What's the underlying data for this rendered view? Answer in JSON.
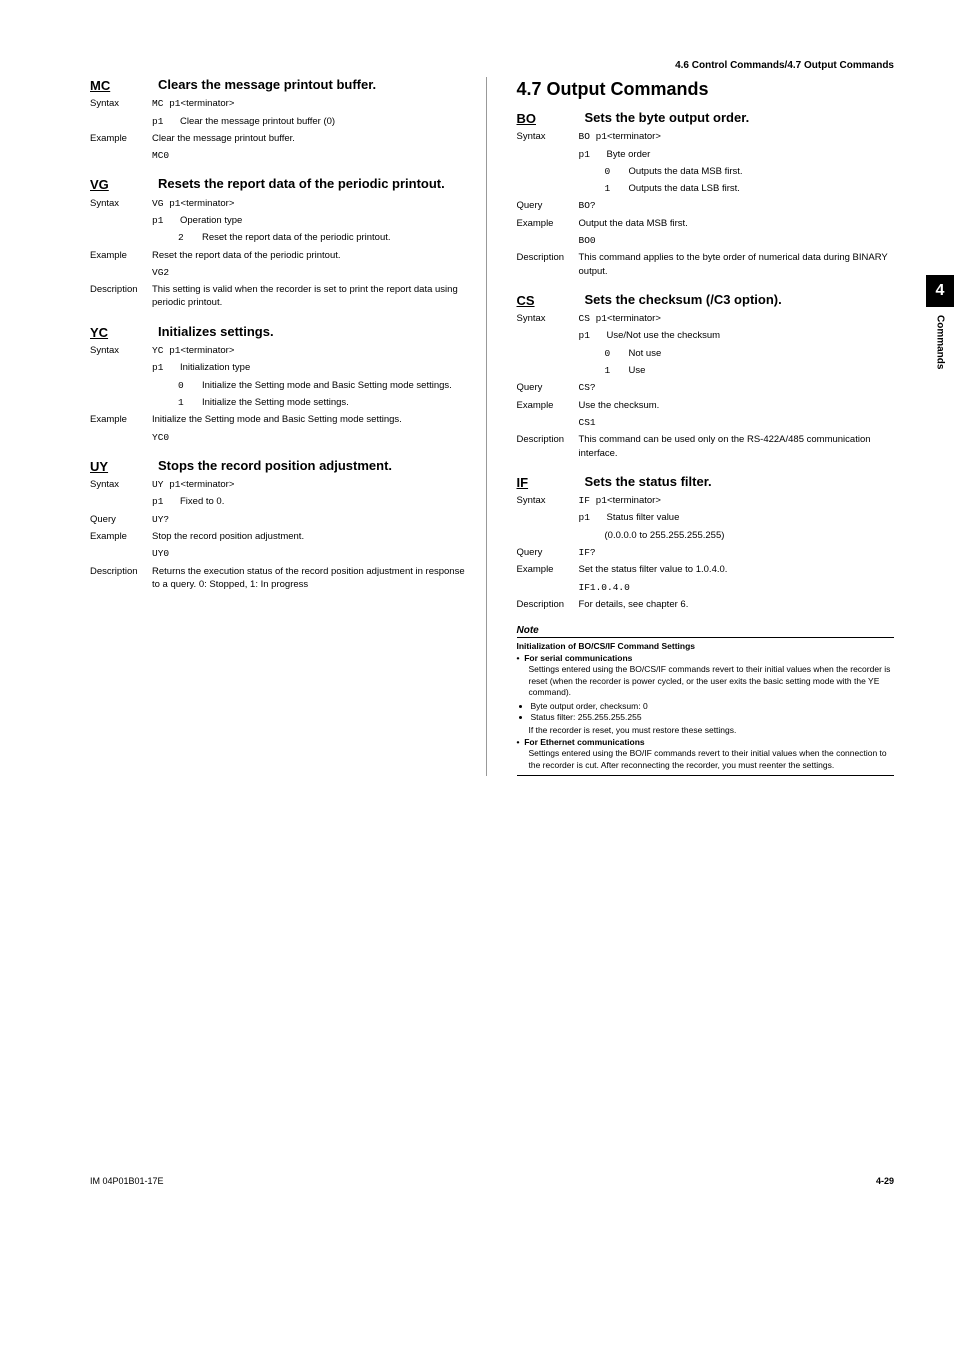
{
  "header": {
    "right": "4.6  Control Commands/4.7  Output Commands"
  },
  "sideTab": {
    "num": "4",
    "label": "Commands"
  },
  "left": {
    "MC": {
      "code": "MC",
      "title": "Clears the message printout buffer.",
      "syntax_prefix": "MC p1",
      "syntax_suffix": "<terminator>",
      "p1_key": "p1",
      "p1_txt": "Clear the message printout buffer (0)",
      "ex_txt": "Clear the message printout buffer.",
      "ex_code": "MC0"
    },
    "VG": {
      "code": "VG",
      "title": "Resets the report data of the periodic printout.",
      "syntax_prefix": "VG p1",
      "syntax_suffix": "<terminator>",
      "p1_key": "p1",
      "p1_txt": "Operation type",
      "v1_key": "2",
      "v1_txt": "Reset the report data of the periodic printout.",
      "ex_txt": "Reset the report data of the periodic printout.",
      "ex_code": "VG2",
      "desc": "This setting is valid when the recorder is set to print the report data using periodic printout."
    },
    "YC": {
      "code": "YC",
      "title": "Initializes settings.",
      "syntax_prefix": "YC p1",
      "syntax_suffix": "<terminator>",
      "p1_key": "p1",
      "p1_txt": "Initialization type",
      "v1_key": "0",
      "v1_txt": "Initialize the Setting mode and Basic Setting mode settings.",
      "v2_key": "1",
      "v2_txt": "Initialize the Setting mode settings.",
      "ex_txt": "Initialize the Setting mode and Basic Setting mode settings.",
      "ex_code": "YC0"
    },
    "UY": {
      "code": "UY",
      "title": "Stops the record position adjustment.",
      "syntax_prefix": "UY p1",
      "syntax_suffix": "<terminator>",
      "p1_key": "p1",
      "p1_txt": "Fixed to 0.",
      "query_code": "UY?",
      "ex_txt": "Stop the record position adjustment.",
      "ex_code": "UY0",
      "desc": "Returns the execution status of the record position adjustment in response to a query. 0: Stopped, 1: In progress"
    }
  },
  "right": {
    "section_title": "4.7   Output Commands",
    "BO": {
      "code": "BO",
      "title": "Sets the byte output order.",
      "syntax_prefix": "BO p1",
      "syntax_suffix": "<terminator>",
      "p1_key": "p1",
      "p1_txt": "Byte order",
      "v1_key": "0",
      "v1_txt": "Outputs the data MSB first.",
      "v2_key": "1",
      "v2_txt": "Outputs the data LSB first.",
      "query_code": "BO?",
      "ex_txt": "Output the data MSB first.",
      "ex_code": "BO0",
      "desc": "This command applies to the byte order of numerical data during BINARY output."
    },
    "CS": {
      "code": "CS",
      "title": "Sets the checksum (/C3 option).",
      "syntax_prefix": "CS p1",
      "syntax_suffix": "<terminator>",
      "p1_key": "p1",
      "p1_txt": "Use/Not use the checksum",
      "v1_key": "0",
      "v1_txt": "Not use",
      "v2_key": "1",
      "v2_txt": "Use",
      "query_code": "CS?",
      "ex_txt": "Use the checksum.",
      "ex_code": "CS1",
      "desc": "This command can be used only on the RS-422A/485 communication interface."
    },
    "IF": {
      "code": "IF",
      "title": "Sets the status filter.",
      "syntax_prefix": "IF p1",
      "syntax_suffix": "<terminator>",
      "p1_key": "p1",
      "p1_txt": "Status filter value",
      "p1_note": "(0.0.0.0 to 255.255.255.255)",
      "query_code": "IF?",
      "ex_txt": "Set the status filter value to 1.0.4.0.",
      "ex_code": "IF1.0.4.0",
      "desc": "For details, see chapter 6."
    },
    "note": {
      "title": "Note",
      "h1": "Initialization of BO/CS/IF Command Settings",
      "b1_head": "For serial communications",
      "b1_txt": "Settings entered using the BO/CS/IF commands revert to their initial values when the recorder is reset (when the recorder is power cycled, or the user exits the basic setting mode with the YE command).",
      "b1_li1": "Byte output order, checksum: 0",
      "b1_li2": "Status filter: 255.255.255.255",
      "b1_txt2": "If the recorder is reset, you must restore these settings.",
      "b2_head": "For Ethernet communications",
      "b2_txt": "Settings entered using the BO/IF commands revert to their initial values when the connection to the recorder is cut. After reconnecting the recorder, you must reenter the settings."
    }
  },
  "labels": {
    "syntax": "Syntax",
    "example": "Example",
    "query": "Query",
    "description": "Description"
  },
  "footer": {
    "left": "IM 04P01B01-17E",
    "right": "4-29"
  }
}
